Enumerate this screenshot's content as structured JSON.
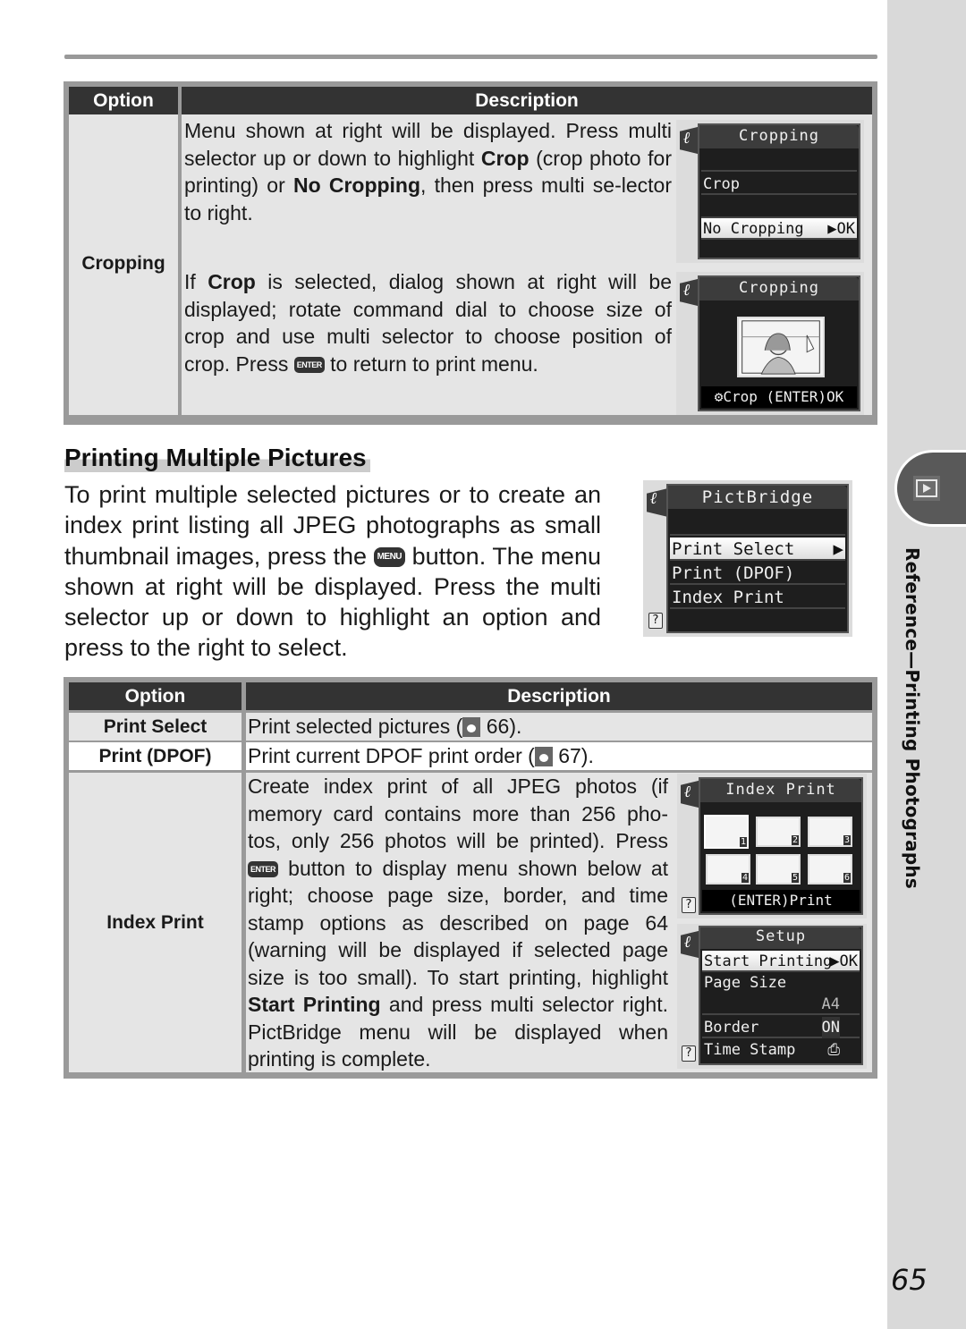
{
  "page": {
    "page_number": "65",
    "side_tab_icon": "playback-icon",
    "side_label": "Reference—Printing Photographs"
  },
  "table1": {
    "headers": {
      "option": "Option",
      "description": "Description"
    },
    "rows": [
      {
        "option": "Cropping",
        "desc_a": {
          "parts": [
            "Menu shown at right will be displayed.  Press multi selector up or down to  highlight ",
            "Crop",
            " (crop photo for printing) or ",
            "No Cropping",
            ", then press multi se-lector to right."
          ]
        },
        "desc_b": {
          "parts": [
            "If ",
            "Crop",
            " is selected, dialog shown at right will be displayed; rotate command dial to choose size of crop and use multi selector to choose position of crop.  Press ",
            "ENTER",
            " to return to print menu."
          ]
        }
      }
    ],
    "screen_crop_menu": {
      "title": "Cropping",
      "items": [
        {
          "label": "",
          "selected": false
        },
        {
          "label": "Crop",
          "selected": false
        },
        {
          "label": "",
          "selected": false
        },
        {
          "label": "No Cropping",
          "selected": true,
          "right": "▶OK"
        },
        {
          "label": "",
          "selected": false
        }
      ]
    },
    "screen_crop_dialog": {
      "title": "Cropping",
      "footer": "⚙Crop  (ENTER)OK"
    }
  },
  "section": {
    "title": "Printing Multiple Pictures",
    "intro_parts": [
      "To print multiple selected pictures or to create an index print listing all JPEG photographs as small thumbnail images, press the ",
      "MENU",
      " button.  The menu shown at right will be displayed.  Press the multi selector up or down to highlight an option and press to the right to select."
    ],
    "screen_pictbridge": {
      "title": "PictBridge",
      "items": [
        {
          "label": "",
          "selected": false
        },
        {
          "label": "Print Select",
          "selected": true,
          "right": "▶"
        },
        {
          "label": "Print (DPOF)",
          "selected": false
        },
        {
          "label": "Index Print",
          "selected": false
        },
        {
          "label": "",
          "selected": false
        }
      ],
      "help": "?"
    }
  },
  "table2": {
    "headers": {
      "option": "Option",
      "description": "Description"
    },
    "rows": [
      {
        "option": "Print Select",
        "desc_pre": "Print selected pictures (",
        "ref": "66",
        "desc_post": ")."
      },
      {
        "option": "Print (DPOF)",
        "desc_pre": "Print current DPOF print order (",
        "ref": "67",
        "desc_post": ")."
      },
      {
        "option": "Index Print",
        "desc_parts": [
          "Create index print of all JPEG photos (if memory card contains more than 256 pho-tos, only 256 photos will be printed).  Press ",
          "ENTER",
          " button to display menu shown below at right; choose page size, border, and time stamp options as described on page 64 (warning will be displayed if selected page size is too small).  To start printing, highlight ",
          "Start Printing",
          " and press multi selector right.  PictBridge menu will be displayed when printing is complete."
        ]
      }
    ],
    "screen_index_print": {
      "title": "Index Print",
      "thumbnails": [
        "1",
        "2",
        "3",
        "4",
        "5",
        "6"
      ],
      "footer": "(ENTER)Print",
      "help": "?"
    },
    "screen_setup": {
      "title": "Setup",
      "items": [
        {
          "label": "Start Printing",
          "selected": true,
          "right": "▶OK"
        },
        {
          "label": "Page Size",
          "selected": false,
          "right": ""
        },
        {
          "label": "",
          "selected": false,
          "right": "A4"
        },
        {
          "label": "Border",
          "selected": false,
          "right": "ON"
        },
        {
          "label": "Time Stamp",
          "selected": false,
          "right": "⎙"
        }
      ],
      "help": "?"
    }
  }
}
